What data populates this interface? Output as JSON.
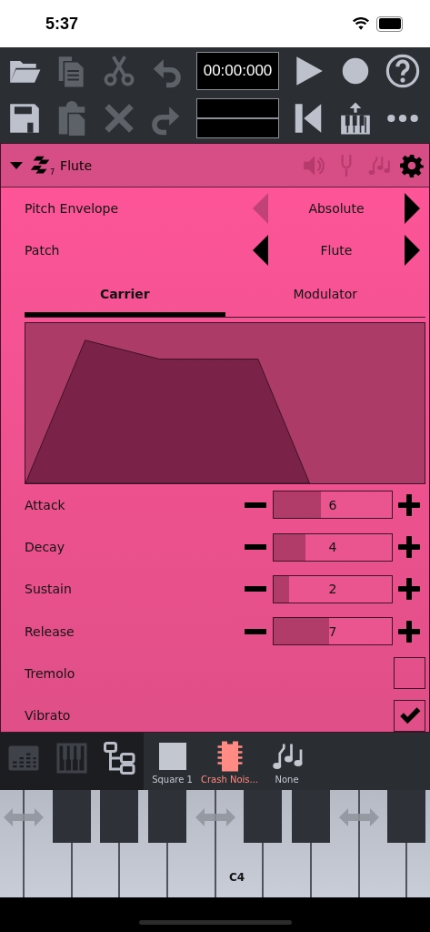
{
  "status_bar": {
    "time": "5:37"
  },
  "toolbar": {
    "rows": [
      [
        {
          "kind": "folder",
          "disabled": false
        },
        {
          "kind": "copy",
          "disabled": true
        },
        {
          "kind": "cut",
          "disabled": true
        },
        {
          "kind": "undo",
          "disabled": true
        },
        {
          "kind": "time",
          "text": "00:00:000"
        },
        {
          "kind": "play",
          "disabled": false
        },
        {
          "kind": "record",
          "disabled": false
        },
        {
          "kind": "help",
          "disabled": false
        }
      ],
      [
        {
          "kind": "save",
          "disabled": false
        },
        {
          "kind": "paste",
          "disabled": true
        },
        {
          "kind": "delete",
          "disabled": true
        },
        {
          "kind": "redo",
          "disabled": true
        },
        {
          "kind": "blank"
        },
        {
          "kind": "skip-back",
          "disabled": false
        },
        {
          "kind": "piano-upload",
          "disabled": false
        },
        {
          "kind": "more",
          "disabled": false
        }
      ]
    ]
  },
  "instrument": {
    "expanded": true,
    "name": "Flute",
    "subscript": "7",
    "header_icons": [
      {
        "kind": "speaker",
        "disabled": true
      },
      {
        "kind": "fork",
        "disabled": true
      },
      {
        "kind": "notes",
        "disabled": true
      },
      {
        "kind": "gear",
        "disabled": false
      }
    ],
    "selectors": [
      {
        "label": "Pitch Envelope",
        "value": "Absolute",
        "prev_disabled": true,
        "next_disabled": false
      },
      {
        "label": "Patch",
        "value": "Flute",
        "prev_disabled": false,
        "next_disabled": false
      }
    ],
    "tabs": [
      {
        "label": "Carrier",
        "selected": true
      },
      {
        "label": "Modulator",
        "selected": false
      }
    ],
    "settings": [
      {
        "kind": "slider",
        "label": "Attack",
        "reading": "6",
        "level": 0.4
      },
      {
        "kind": "slider",
        "label": "Decay",
        "reading": "4",
        "level": 0.27
      },
      {
        "kind": "slider",
        "label": "Sustain",
        "reading": "2",
        "level": 0.13
      },
      {
        "kind": "slider",
        "label": "Release",
        "reading": "7",
        "level": 0.47
      },
      {
        "kind": "checkbox",
        "label": "Tremolo",
        "checked": false
      },
      {
        "kind": "checkbox",
        "label": "Vibrato",
        "checked": true
      }
    ]
  },
  "views": [
    {
      "kind": "mixer",
      "selected": false
    },
    {
      "kind": "piano",
      "selected": false
    },
    {
      "kind": "tree",
      "selected": true
    }
  ],
  "channels": [
    {
      "kind": "square",
      "label": "Square 1",
      "selected": false
    },
    {
      "kind": "chip",
      "label": "Crash Nois...",
      "selected": true
    },
    {
      "kind": "notes",
      "label": "None",
      "selected": false
    }
  ],
  "keyboard": {
    "note_label": "C4"
  }
}
